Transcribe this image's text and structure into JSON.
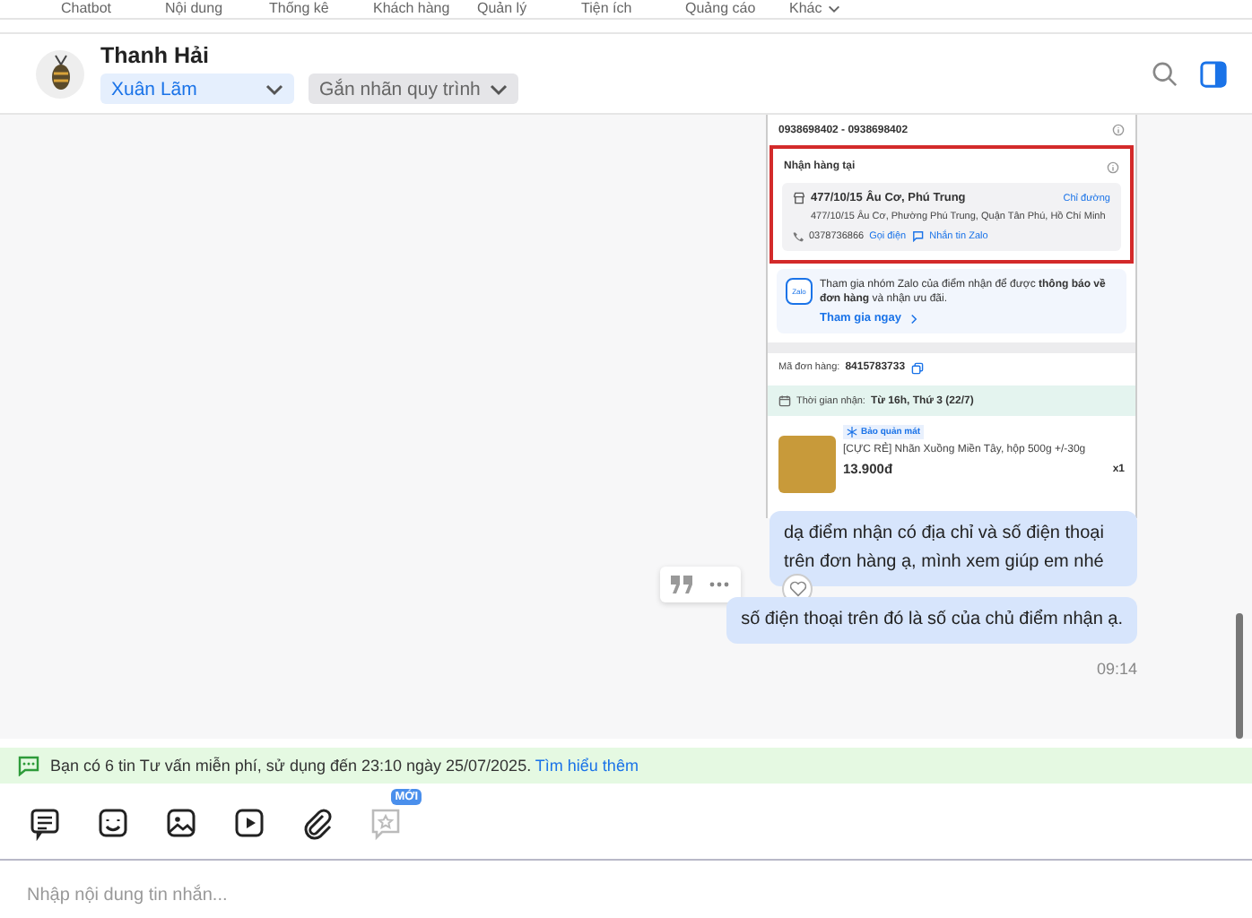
{
  "top_nav": {
    "items": [
      {
        "label": "Chatbot",
        "dropdown": false
      },
      {
        "label": "Nội dung",
        "dropdown": false
      },
      {
        "label": "Thống kê",
        "dropdown": false
      },
      {
        "label": "Khách hàng",
        "dropdown": false
      },
      {
        "label": "Quản lý",
        "dropdown": false
      },
      {
        "label": "Tiện ích",
        "dropdown": false
      },
      {
        "label": "Quảng cáo",
        "dropdown": false
      },
      {
        "label": "Khác",
        "dropdown": true
      }
    ]
  },
  "conversation": {
    "name": "Thanh Hải",
    "assignee": "Xuân Lãm",
    "label_select": {
      "placeholder": "Gắn nhãn quy trình"
    }
  },
  "order_screenshot": {
    "phone_line": "0938698402 - 0938698402",
    "pickup": {
      "title": "Nhận hàng tại",
      "store": "477/10/15 Âu Cơ, Phú Trung",
      "directions": "Chỉ đường",
      "address": "477/10/15 Âu Cơ, Phường Phú Trung, Quận Tân Phú, Hồ Chí Minh",
      "phone": "0378736866",
      "call": "Gọi điện",
      "zalo_chat": "Nhắn tin Zalo",
      "highlighted": true
    },
    "zalo_group": {
      "logo": "Zalo",
      "text": "Tham gia nhóm Zalo của điểm nhận để được **thông báo về đơn hàng** và nhận ưu đãi.",
      "link": "Tham gia ngay"
    },
    "order_id_label": "Mã đơn hàng:",
    "order_id": "8415783733",
    "pickup_time_label": "Thời gian nhận:",
    "pickup_time": "Từ 16h, Thứ 3 (22/7)",
    "product": {
      "tag": "Bảo quản mát",
      "name": "[CỰC RẺ] Nhãn Xuồng Miền Tây, hộp 500g +/-30g",
      "price": "13.900đ",
      "quantity": "x1"
    }
  },
  "messages": [
    {
      "text": "dạ điểm nhận có địa chỉ và số điện thoại trên đơn hàng ạ, mình xem giúp em nhé",
      "hovered": true
    },
    {
      "text": "số điện thoại trên đó là số của chủ điểm nhận ạ.",
      "hovered": false
    }
  ],
  "time": "09:14",
  "notice": {
    "text": "Bạn có 6 tin Tư vấn miễn phí, sử dụng đến 23:10 ngày 25/07/2025.",
    "link": "Tìm hiểu thêm"
  },
  "composer_tools": [
    {
      "disabled": false
    },
    {
      "disabled": false
    },
    {
      "disabled": false
    },
    {
      "disabled": false
    },
    {
      "disabled": false
    },
    {
      "disabled": true,
      "badge": "MỚI"
    }
  ],
  "composer": {
    "placeholder": "Nhập nội dung tin nhắn..."
  }
}
